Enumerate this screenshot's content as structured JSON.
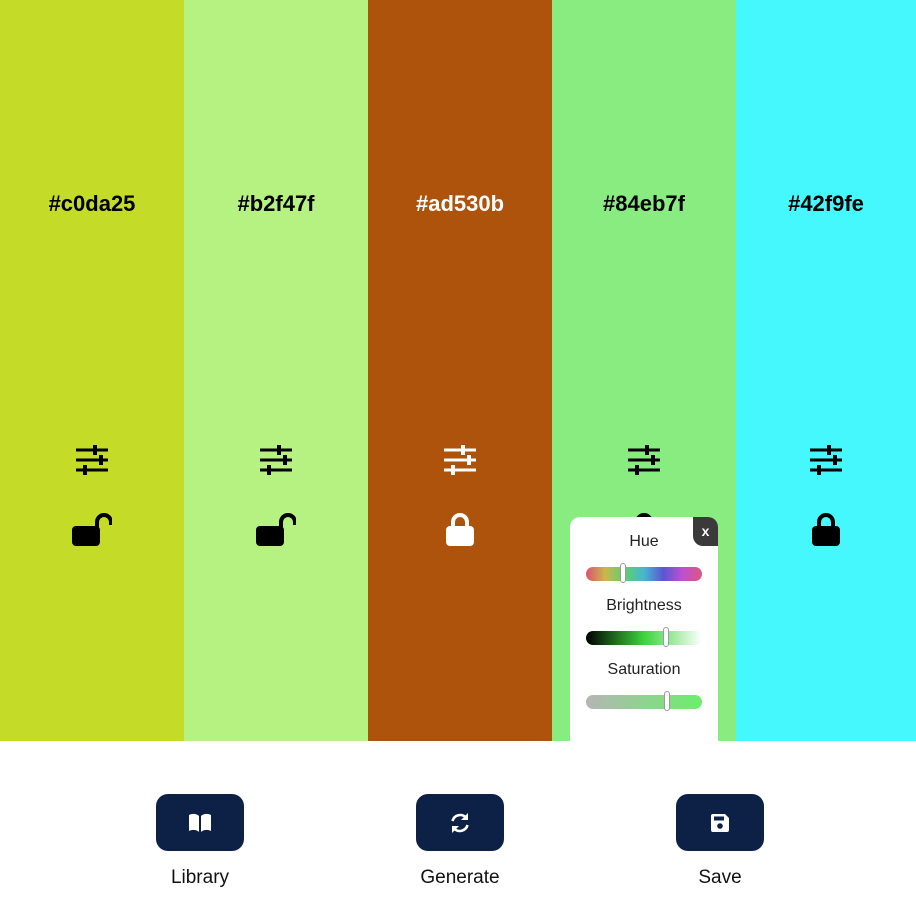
{
  "palette": {
    "columns": [
      {
        "hex": "#c0da25",
        "bg": "#c4dc27",
        "text_color": "#000000",
        "lock_state": "unlocked"
      },
      {
        "hex": "#b2f47f",
        "bg": "#b6f281",
        "text_color": "#000000",
        "lock_state": "unlocked"
      },
      {
        "hex": "#ad530b",
        "bg": "#ae530c",
        "text_color": "#ffffff",
        "lock_state": "locked"
      },
      {
        "hex": "#84eb7f",
        "bg": "#88ec80",
        "text_color": "#000000",
        "lock_state": "locked"
      },
      {
        "hex": "#42f9fe",
        "bg": "#44f8fd",
        "text_color": "#000000",
        "lock_state": "locked"
      }
    ]
  },
  "adjust_panel": {
    "close_label": "x",
    "hue_label": "Hue",
    "brightness_label": "Brightness",
    "saturation_label": "Saturation",
    "hue_value": 0.33,
    "brightness_value": 0.7,
    "saturation_value": 0.71,
    "hue_gradient": [
      "#d9546f",
      "#c9b84d",
      "#5fcf6b",
      "#47b6d0",
      "#5b55d4",
      "#c04fd1",
      "#d85a7d"
    ],
    "brightness_gradient": [
      "#000000",
      "#3cd43c",
      "#ffffff"
    ],
    "saturation_gradient": [
      "#b5b5b5",
      "#6bef6b"
    ]
  },
  "footer": {
    "library_label": "Library",
    "generate_label": "Generate",
    "save_label": "Save"
  },
  "icons": {
    "adjust": "sliders-icon",
    "lock": "lock-icon",
    "unlock": "unlock-icon",
    "library": "book-open-icon",
    "generate": "refresh-icon",
    "save": "floppy-disk-icon"
  }
}
